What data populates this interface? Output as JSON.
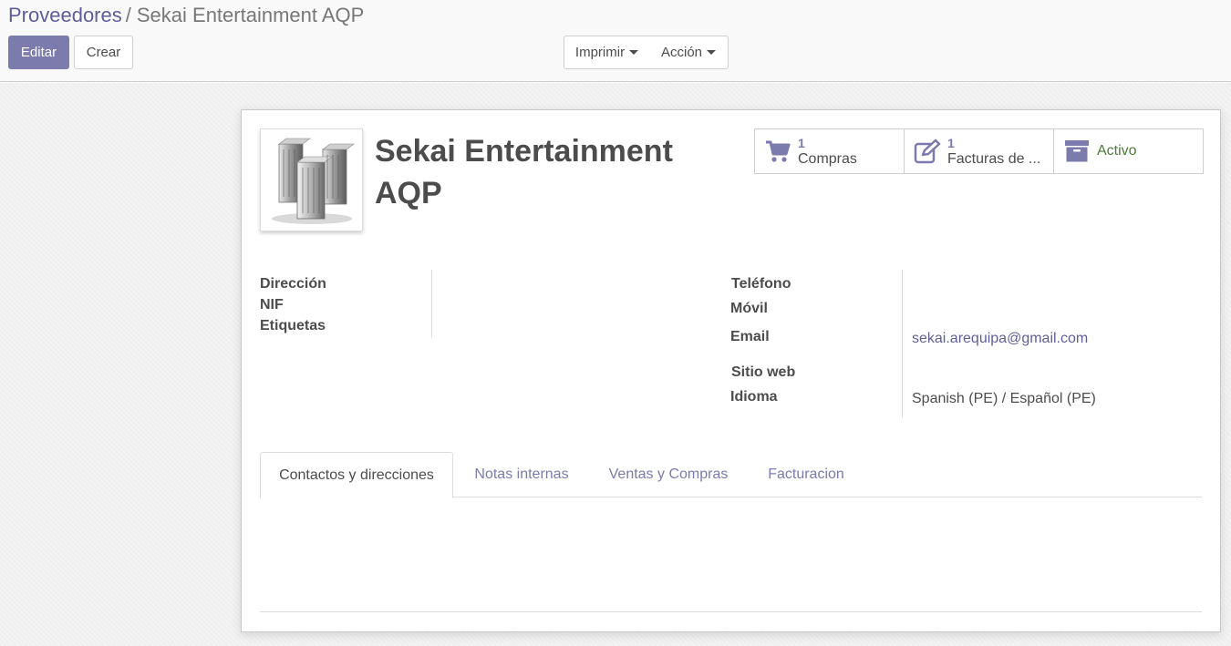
{
  "breadcrumb": {
    "parent": "Proveedores",
    "separator": "/",
    "current": "Sekai Entertainment AQP"
  },
  "toolbar": {
    "edit_label": "Editar",
    "create_label": "Crear",
    "print_label": "Imprimir",
    "action_label": "Acción"
  },
  "partner": {
    "name": "Sekai Entertainment AQP",
    "avatar_icon": "company-buildings-icon"
  },
  "stat_buttons": {
    "purchases": {
      "value": "1",
      "label": "Compras",
      "icon": "shopping-cart-icon"
    },
    "invoices": {
      "value": "1",
      "label": "Facturas de ...",
      "icon": "pencil-square-icon"
    },
    "active": {
      "label": "Activo",
      "icon": "archive-icon"
    }
  },
  "fields_left": {
    "address_label": "Dirección",
    "vat_label": "NIF",
    "tags_label": "Etiquetas"
  },
  "fields_right": {
    "phone_label": "Teléfono",
    "mobile_label": "Móvil",
    "email_label": "Email",
    "email_value": "sekai.arequipa@gmail.com",
    "website_label": "Sitio web",
    "language_label": "Idioma",
    "language_value": "Spanish (PE) / Español (PE)"
  },
  "tabs": [
    {
      "label": "Contactos y direcciones",
      "active": true
    },
    {
      "label": "Notas internas",
      "active": false
    },
    {
      "label": "Ventas y Compras",
      "active": false
    },
    {
      "label": "Facturacion",
      "active": false
    }
  ],
  "colors": {
    "primary": "#7c7bad",
    "link": "#5f5e97",
    "active_green": "#4d7a3c"
  }
}
